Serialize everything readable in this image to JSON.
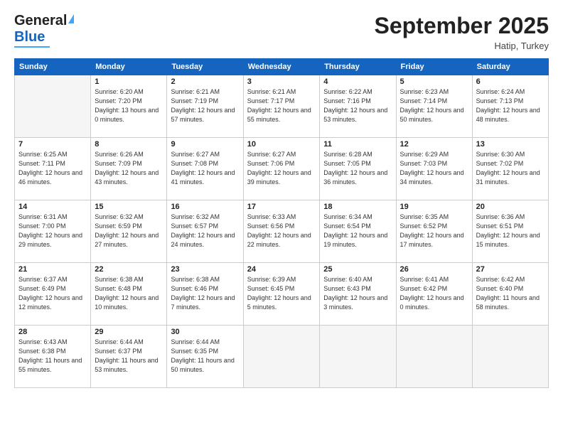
{
  "header": {
    "logo_general": "General",
    "logo_blue": "Blue",
    "month_title": "September 2025",
    "location": "Hatip, Turkey"
  },
  "days_of_week": [
    "Sunday",
    "Monday",
    "Tuesday",
    "Wednesday",
    "Thursday",
    "Friday",
    "Saturday"
  ],
  "weeks": [
    [
      {
        "day": "",
        "empty": true
      },
      {
        "day": "1",
        "sunrise": "6:20 AM",
        "sunset": "7:20 PM",
        "daylight": "13 hours and 0 minutes."
      },
      {
        "day": "2",
        "sunrise": "6:21 AM",
        "sunset": "7:19 PM",
        "daylight": "12 hours and 57 minutes."
      },
      {
        "day": "3",
        "sunrise": "6:21 AM",
        "sunset": "7:17 PM",
        "daylight": "12 hours and 55 minutes."
      },
      {
        "day": "4",
        "sunrise": "6:22 AM",
        "sunset": "7:16 PM",
        "daylight": "12 hours and 53 minutes."
      },
      {
        "day": "5",
        "sunrise": "6:23 AM",
        "sunset": "7:14 PM",
        "daylight": "12 hours and 50 minutes."
      },
      {
        "day": "6",
        "sunrise": "6:24 AM",
        "sunset": "7:13 PM",
        "daylight": "12 hours and 48 minutes."
      }
    ],
    [
      {
        "day": "7",
        "sunrise": "6:25 AM",
        "sunset": "7:11 PM",
        "daylight": "12 hours and 46 minutes."
      },
      {
        "day": "8",
        "sunrise": "6:26 AM",
        "sunset": "7:09 PM",
        "daylight": "12 hours and 43 minutes."
      },
      {
        "day": "9",
        "sunrise": "6:27 AM",
        "sunset": "7:08 PM",
        "daylight": "12 hours and 41 minutes."
      },
      {
        "day": "10",
        "sunrise": "6:27 AM",
        "sunset": "7:06 PM",
        "daylight": "12 hours and 39 minutes."
      },
      {
        "day": "11",
        "sunrise": "6:28 AM",
        "sunset": "7:05 PM",
        "daylight": "12 hours and 36 minutes."
      },
      {
        "day": "12",
        "sunrise": "6:29 AM",
        "sunset": "7:03 PM",
        "daylight": "12 hours and 34 minutes."
      },
      {
        "day": "13",
        "sunrise": "6:30 AM",
        "sunset": "7:02 PM",
        "daylight": "12 hours and 31 minutes."
      }
    ],
    [
      {
        "day": "14",
        "sunrise": "6:31 AM",
        "sunset": "7:00 PM",
        "daylight": "12 hours and 29 minutes."
      },
      {
        "day": "15",
        "sunrise": "6:32 AM",
        "sunset": "6:59 PM",
        "daylight": "12 hours and 27 minutes."
      },
      {
        "day": "16",
        "sunrise": "6:32 AM",
        "sunset": "6:57 PM",
        "daylight": "12 hours and 24 minutes."
      },
      {
        "day": "17",
        "sunrise": "6:33 AM",
        "sunset": "6:56 PM",
        "daylight": "12 hours and 22 minutes."
      },
      {
        "day": "18",
        "sunrise": "6:34 AM",
        "sunset": "6:54 PM",
        "daylight": "12 hours and 19 minutes."
      },
      {
        "day": "19",
        "sunrise": "6:35 AM",
        "sunset": "6:52 PM",
        "daylight": "12 hours and 17 minutes."
      },
      {
        "day": "20",
        "sunrise": "6:36 AM",
        "sunset": "6:51 PM",
        "daylight": "12 hours and 15 minutes."
      }
    ],
    [
      {
        "day": "21",
        "sunrise": "6:37 AM",
        "sunset": "6:49 PM",
        "daylight": "12 hours and 12 minutes."
      },
      {
        "day": "22",
        "sunrise": "6:38 AM",
        "sunset": "6:48 PM",
        "daylight": "12 hours and 10 minutes."
      },
      {
        "day": "23",
        "sunrise": "6:38 AM",
        "sunset": "6:46 PM",
        "daylight": "12 hours and 7 minutes."
      },
      {
        "day": "24",
        "sunrise": "6:39 AM",
        "sunset": "6:45 PM",
        "daylight": "12 hours and 5 minutes."
      },
      {
        "day": "25",
        "sunrise": "6:40 AM",
        "sunset": "6:43 PM",
        "daylight": "12 hours and 3 minutes."
      },
      {
        "day": "26",
        "sunrise": "6:41 AM",
        "sunset": "6:42 PM",
        "daylight": "12 hours and 0 minutes."
      },
      {
        "day": "27",
        "sunrise": "6:42 AM",
        "sunset": "6:40 PM",
        "daylight": "11 hours and 58 minutes."
      }
    ],
    [
      {
        "day": "28",
        "sunrise": "6:43 AM",
        "sunset": "6:38 PM",
        "daylight": "11 hours and 55 minutes."
      },
      {
        "day": "29",
        "sunrise": "6:44 AM",
        "sunset": "6:37 PM",
        "daylight": "11 hours and 53 minutes."
      },
      {
        "day": "30",
        "sunrise": "6:44 AM",
        "sunset": "6:35 PM",
        "daylight": "11 hours and 50 minutes."
      },
      {
        "day": "",
        "empty": true
      },
      {
        "day": "",
        "empty": true
      },
      {
        "day": "",
        "empty": true
      },
      {
        "day": "",
        "empty": true
      }
    ]
  ]
}
